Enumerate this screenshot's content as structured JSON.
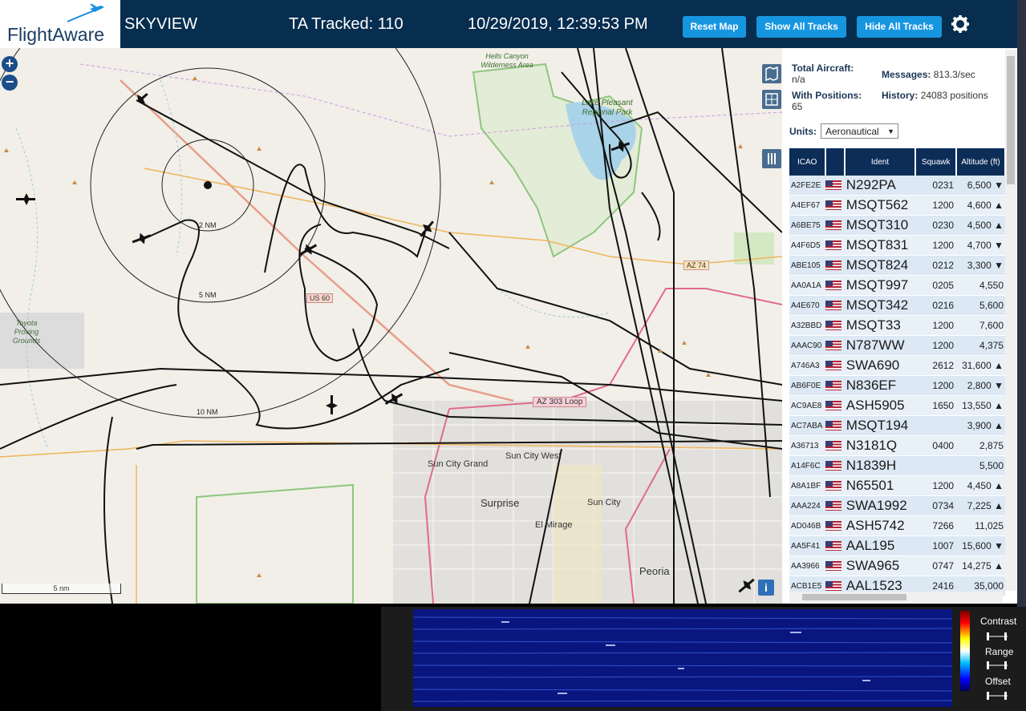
{
  "header": {
    "logo_text": "FlightAware",
    "app_name": "SKYVIEW",
    "tracked_label": "TA Tracked: 110",
    "datetime": "10/29/2019, 12:39:53 PM",
    "buttons": {
      "reset_map": "Reset Map",
      "show_all": "Show All Tracks",
      "hide_all": "Hide All Tracks"
    }
  },
  "map": {
    "zoom_in": "+",
    "zoom_out": "−",
    "scale_label": "5 nm",
    "info": "i",
    "labels": {
      "hells_canyon": "Hells Canyon Wilderness Area",
      "lake_pleasant": "Lake Pleasant Regional Park",
      "toyota": "Toyota Proving Grounds",
      "sun_city_grand": "Sun City Grand",
      "sun_city_west": "Sun City West",
      "surprise": "Surprise",
      "sun_city": "Sun City",
      "el_mirage": "El Mirage",
      "peoria": "Peoria",
      "us60": "US 60",
      "az74": "AZ 74",
      "az303": "AZ 303 Loop",
      "ring2": "2 NM",
      "ring5": "5 NM",
      "ring10": "10 NM"
    }
  },
  "panel": {
    "total_aircraft_label": "Total Aircraft:",
    "total_aircraft_value": "n/a",
    "messages_label": "Messages:",
    "messages_value": "813.3/sec",
    "with_positions_label": "With Positions:",
    "with_positions_value": "65",
    "history_label": "History:",
    "history_value": "24083 positions",
    "units_label": "Units:",
    "units_value": "Aeronautical",
    "columns": {
      "icao": "ICAO",
      "ident": "Ident",
      "squawk": "Squawk",
      "altitude": "Altitude (ft)"
    },
    "rows": [
      {
        "icao": "A2FE2E",
        "ident": "N292PA",
        "squawk": "0231",
        "alt": "6,500 ▼"
      },
      {
        "icao": "A4EF67",
        "ident": "MSQT562",
        "squawk": "1200",
        "alt": "4,600 ▲"
      },
      {
        "icao": "A6BE75",
        "ident": "MSQT310",
        "squawk": "0230",
        "alt": "4,500 ▲"
      },
      {
        "icao": "A4F6D5",
        "ident": "MSQT831",
        "squawk": "1200",
        "alt": "4,700 ▼"
      },
      {
        "icao": "ABE105",
        "ident": "MSQT824",
        "squawk": "0212",
        "alt": "3,300 ▼"
      },
      {
        "icao": "AA0A1A",
        "ident": "MSQT997",
        "squawk": "0205",
        "alt": "4,550"
      },
      {
        "icao": "A4E670",
        "ident": "MSQT342",
        "squawk": "0216",
        "alt": "5,600"
      },
      {
        "icao": "A32BBD",
        "ident": "MSQT33",
        "squawk": "1200",
        "alt": "7,600"
      },
      {
        "icao": "AAAC90",
        "ident": "N787WW",
        "squawk": "1200",
        "alt": "4,375"
      },
      {
        "icao": "A746A3",
        "ident": "SWA690",
        "squawk": "2612",
        "alt": "31,600 ▲"
      },
      {
        "icao": "AB6F0E",
        "ident": "N836EF",
        "squawk": "1200",
        "alt": "2,800 ▼"
      },
      {
        "icao": "AC9AE8",
        "ident": "ASH5905",
        "squawk": "1650",
        "alt": "13,550 ▲"
      },
      {
        "icao": "AC7ABA",
        "ident": "MSQT194",
        "squawk": "",
        "alt": "3,900 ▲"
      },
      {
        "icao": "A36713",
        "ident": "N3181Q",
        "squawk": "0400",
        "alt": "2,875"
      },
      {
        "icao": "A14F6C",
        "ident": "N1839H",
        "squawk": "",
        "alt": "5,500"
      },
      {
        "icao": "A8A1BF",
        "ident": "N65501",
        "squawk": "1200",
        "alt": "4,450 ▲"
      },
      {
        "icao": "AAA224",
        "ident": "SWA1992",
        "squawk": "0734",
        "alt": "7,225 ▲"
      },
      {
        "icao": "AD046B",
        "ident": "ASH5742",
        "squawk": "7266",
        "alt": "11,025"
      },
      {
        "icao": "AA5F41",
        "ident": "AAL195",
        "squawk": "1007",
        "alt": "15,600 ▼"
      },
      {
        "icao": "AA3966",
        "ident": "SWA965",
        "squawk": "0747",
        "alt": "14,275 ▲"
      },
      {
        "icao": "ACB1E5",
        "ident": "AAL1523",
        "squawk": "2416",
        "alt": "35,000"
      }
    ]
  },
  "waterfall": {
    "contrast": "Contrast",
    "range": "Range",
    "offset": "Offset"
  },
  "colors": {
    "header_bg": "#072d4f",
    "button_bg": "#1796e0",
    "table_header": "#0c2d57",
    "map_bg": "#f1efe8"
  }
}
